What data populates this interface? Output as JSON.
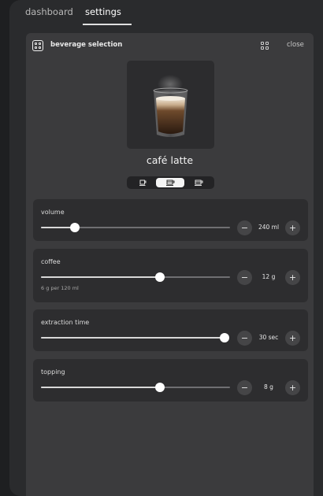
{
  "tabs": [
    {
      "label": "dashboard",
      "active": false
    },
    {
      "label": "settings",
      "active": true
    }
  ],
  "panel": {
    "title": "beverage selection",
    "app_icon": "grid-app-icon",
    "grid_icon": "grid-icon",
    "close_label": "close"
  },
  "beverage": {
    "name": "café latte",
    "image": "latte-glass-image",
    "sizes": [
      {
        "icon": "cup-small-icon",
        "active": false
      },
      {
        "icon": "cup-medium-icon",
        "active": true
      },
      {
        "icon": "cup-large-icon",
        "active": false
      }
    ]
  },
  "settings": [
    {
      "label": "volume",
      "value": "240 ml",
      "fraction": 0.18,
      "sub": ""
    },
    {
      "label": "coffee",
      "value": "12 g",
      "fraction": 0.63,
      "sub": "6 g per 120 ml"
    },
    {
      "label": "extraction time",
      "value": "30 sec",
      "fraction": 1.0,
      "sub": ""
    },
    {
      "label": "topping",
      "value": "8 g",
      "fraction": 0.63,
      "sub": ""
    }
  ],
  "buttons": {
    "minus": "−",
    "plus": "+"
  },
  "colors": {
    "accent": "#ffffff",
    "card": "#2d2d2f",
    "panel": "#3b3b3d",
    "background": "#1e1f21"
  }
}
